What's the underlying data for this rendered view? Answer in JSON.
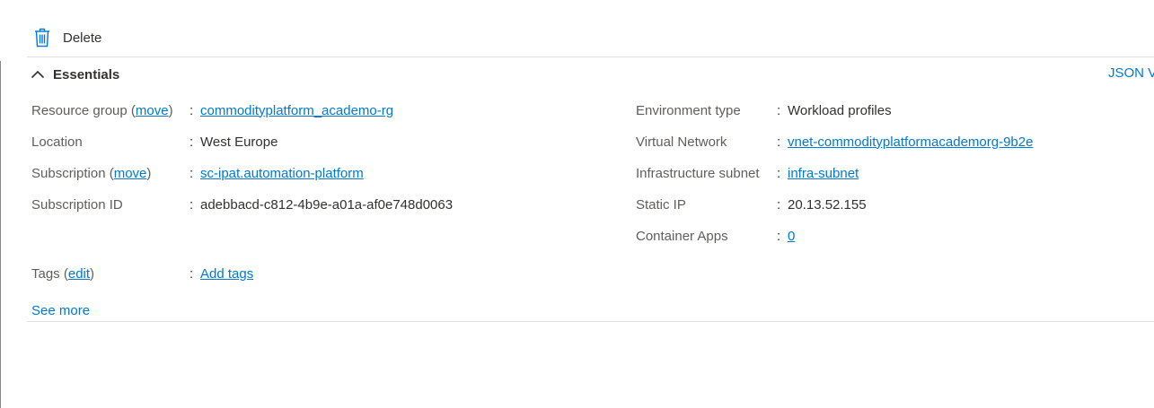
{
  "toolbar": {
    "delete_label": "Delete"
  },
  "essentials": {
    "title": "Essentials",
    "json_view_label": "JSON V",
    "left": {
      "resource_group": {
        "label": "Resource group",
        "action": "move",
        "value": "commodityplatform_academo-rg"
      },
      "location": {
        "label": "Location",
        "value": "West Europe"
      },
      "subscription": {
        "label": "Subscription",
        "action": "move",
        "value": "sc-ipat.automation-platform"
      },
      "subscription_id": {
        "label": "Subscription ID",
        "value": "adebbacd-c812-4b9e-a01a-af0e748d0063"
      }
    },
    "right": {
      "environment_type": {
        "label": "Environment type",
        "value": "Workload profiles"
      },
      "virtual_network": {
        "label": "Virtual Network",
        "value": "vnet-commodityplatformacademorg-9b2e"
      },
      "infrastructure_subnet": {
        "label": "Infrastructure subnet",
        "value": "infra-subnet"
      },
      "static_ip": {
        "label": "Static IP",
        "value": "20.13.52.155"
      },
      "container_apps": {
        "label": "Container Apps",
        "value": "0"
      }
    },
    "tags": {
      "label": "Tags",
      "action": "edit",
      "value": "Add tags"
    },
    "separator": ":",
    "see_more_label": "See more"
  },
  "colors": {
    "link": "#0078d4",
    "label": "#605e5c",
    "text": "#323130",
    "divider": "#e1dfdd"
  },
  "icons": {
    "delete": "trash-icon",
    "collapse": "chevron-up-icon"
  }
}
